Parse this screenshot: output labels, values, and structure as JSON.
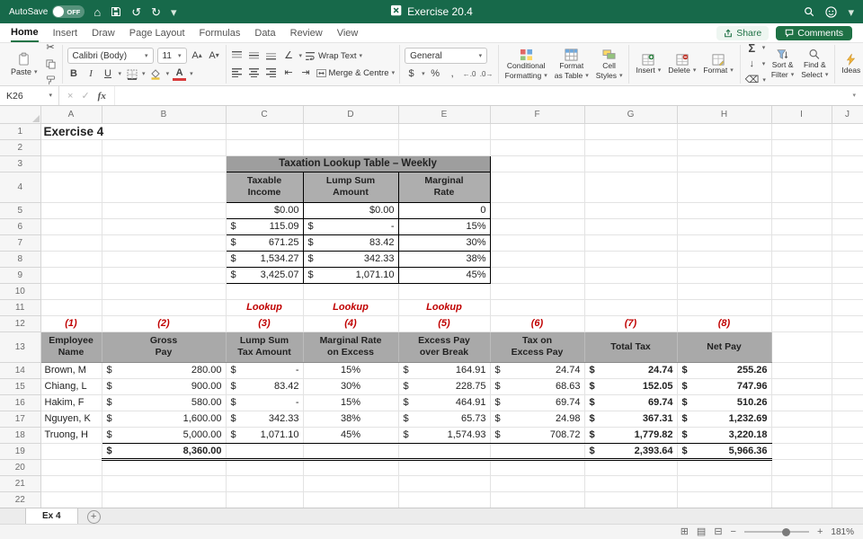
{
  "colors": {
    "titlebar": "#17694a",
    "accent_green": "#217346",
    "header_fill": "#a9a9a9",
    "label_red": "#c00000"
  },
  "titlebar": {
    "autosave_label": "AutoSave",
    "autosave_state": "OFF",
    "doc_title": "Exercise 20.4"
  },
  "ribbon_tabs": {
    "tabs": [
      "Home",
      "Insert",
      "Draw",
      "Page Layout",
      "Formulas",
      "Data",
      "Review",
      "View"
    ],
    "active_tab": "Home",
    "share": "Share",
    "comments": "Comments"
  },
  "ribbon": {
    "paste": "Paste",
    "font_name": "Calibri (Body)",
    "font_size": "11",
    "wrap_text": "Wrap Text",
    "merge_centre": "Merge & Centre",
    "number_format": "General",
    "cond1": "Conditional",
    "cond2": "Formatting",
    "fat1": "Format",
    "fat2": "as Table",
    "cs1": "Cell",
    "cs2": "Styles",
    "insert": "Insert",
    "delete": "Delete",
    "format": "Format",
    "sf1": "Sort &",
    "sf2": "Filter",
    "fs1": "Find &",
    "fs2": "Select",
    "ideas": "Ideas"
  },
  "formula_bar": {
    "name_box": "K26",
    "fx": "fx",
    "formula": ""
  },
  "grid": {
    "col_letters": [
      "A",
      "B",
      "C",
      "D",
      "E",
      "F",
      "G",
      "H",
      "I",
      "J"
    ],
    "row_numbers": [
      "1",
      "2",
      "3",
      "4",
      "5",
      "6",
      "7",
      "8",
      "9",
      "10",
      "11",
      "12",
      "13",
      "14",
      "15",
      "16",
      "17",
      "18",
      "19",
      "20",
      "21",
      "22"
    ]
  },
  "sheet": {
    "title_a1": "Exercise 4",
    "dollar": "$",
    "lookup": {
      "title": "Taxation Lookup Table – Weekly",
      "h1l1": "Taxable",
      "h1l2": "Income",
      "h2l1": "Lump Sum",
      "h2l2": "Amount",
      "h3l1": "Marginal",
      "h3l2": "Rate",
      "rows": [
        {
          "c_s": "",
          "c_v": "$0.00",
          "d_s": "",
          "d_v": "$0.00",
          "e": "0"
        },
        {
          "c_s": "$",
          "c_v": "115.09",
          "d_s": "$",
          "d_v": "-",
          "e": "15%"
        },
        {
          "c_s": "$",
          "c_v": "671.25",
          "d_s": "$",
          "d_v": "83.42",
          "e": "30%"
        },
        {
          "c_s": "$",
          "c_v": "1,534.27",
          "d_s": "$",
          "d_v": "342.33",
          "e": "38%"
        },
        {
          "c_s": "$",
          "c_v": "3,425.07",
          "d_s": "$",
          "d_v": "1,071.10",
          "e": "45%"
        }
      ]
    },
    "lookup_label": "Lookup",
    "col_nums": [
      "(1)",
      "(2)",
      "(3)",
      "(4)",
      "(5)",
      "(6)",
      "(7)",
      "(8)"
    ],
    "emp_headers": [
      {
        "l1": "Employee",
        "l2": "Name"
      },
      {
        "l1": "Gross",
        "l2": "Pay"
      },
      {
        "l1": "Lump Sum",
        "l2": "Tax Amount"
      },
      {
        "l1": "Marginal Rate",
        "l2": "on Excess"
      },
      {
        "l1": "Excess Pay",
        "l2": "over Break"
      },
      {
        "l1": "Tax on",
        "l2": "Excess Pay"
      },
      {
        "l1": "",
        "l2": "Total Tax"
      },
      {
        "l1": "",
        "l2": "Net Pay"
      }
    ],
    "employees": [
      {
        "name": "Brown, M",
        "gross": "280.00",
        "lump": "-",
        "rate": "15%",
        "excess": "164.91",
        "tax_excess": "24.74",
        "total_tax": "24.74",
        "net": "255.26"
      },
      {
        "name": "Chiang, L",
        "gross": "900.00",
        "lump": "83.42",
        "rate": "30%",
        "excess": "228.75",
        "tax_excess": "68.63",
        "total_tax": "152.05",
        "net": "747.96"
      },
      {
        "name": "Hakim, F",
        "gross": "580.00",
        "lump": "-",
        "rate": "15%",
        "excess": "464.91",
        "tax_excess": "69.74",
        "total_tax": "69.74",
        "net": "510.26"
      },
      {
        "name": "Nguyen, K",
        "gross": "1,600.00",
        "lump": "342.33",
        "rate": "38%",
        "excess": "65.73",
        "tax_excess": "24.98",
        "total_tax": "367.31",
        "net": "1,232.69"
      },
      {
        "name": "Truong, H",
        "gross": "5,000.00",
        "lump": "1,071.10",
        "rate": "45%",
        "excess": "1,574.93",
        "tax_excess": "708.72",
        "total_tax": "1,779.82",
        "net": "3,220.18"
      }
    ],
    "totals": {
      "gross": "8,360.00",
      "total_tax": "2,393.64",
      "net": "5,966.36"
    }
  },
  "sheet_tabs": {
    "active": "Ex 4",
    "add": "+"
  },
  "status_bar": {
    "zoom": "181%"
  }
}
